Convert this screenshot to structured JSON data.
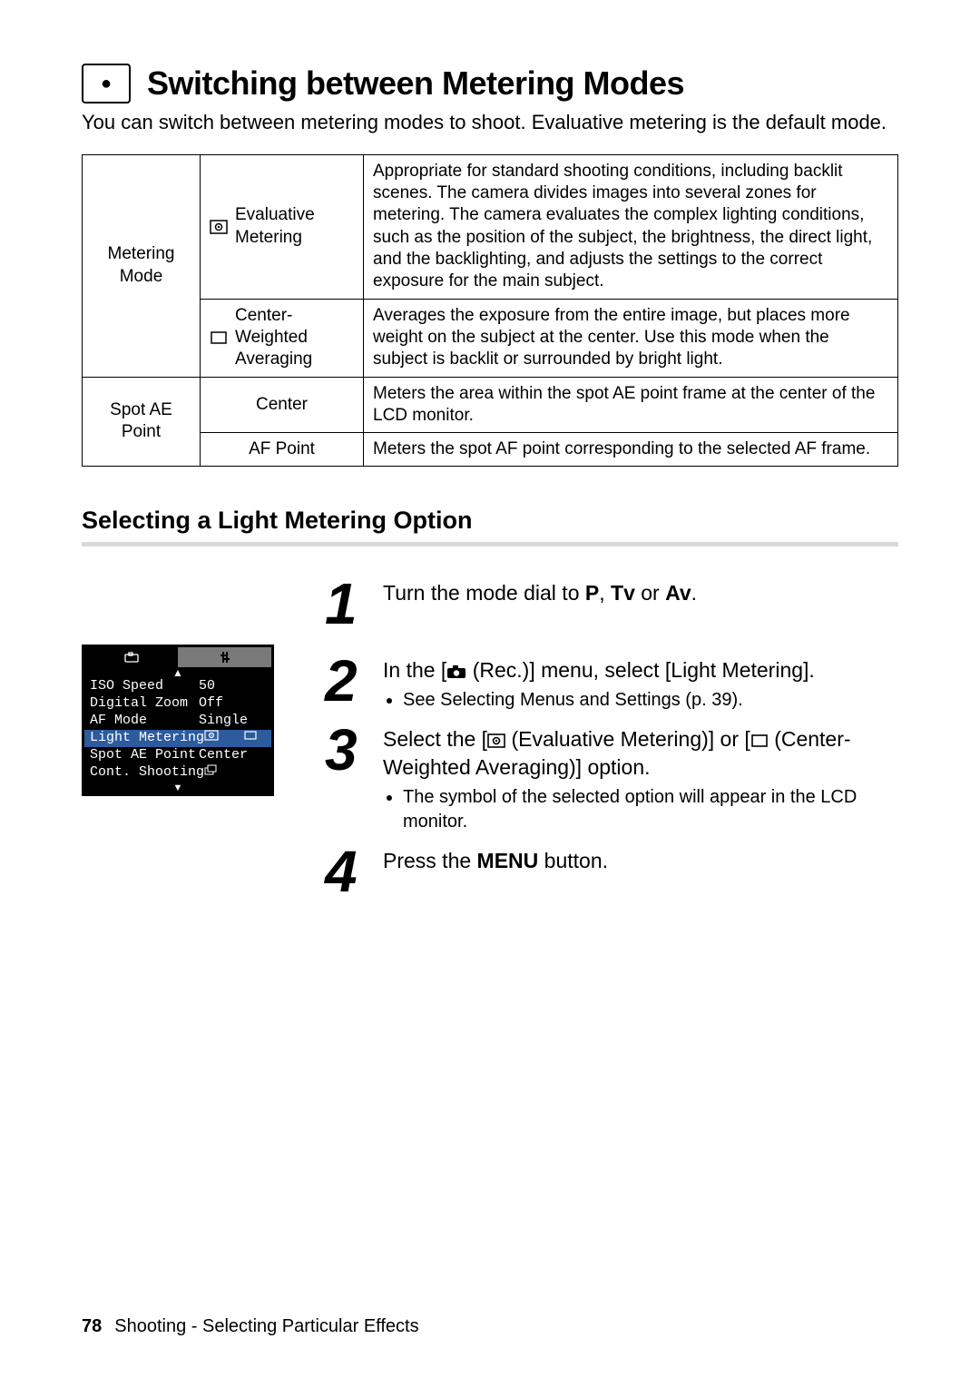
{
  "title": "Switching between Metering Modes",
  "intro": "You can switch between metering modes to shoot. Evaluative metering is the default mode.",
  "table": {
    "rows": [
      {
        "group": "Metering Mode",
        "label": "Evaluative Metering",
        "icon": "evaluative-metering-icon",
        "desc": "Appropriate for standard shooting conditions, including backlit scenes. The camera divides images into several zones for metering. The camera evaluates the complex lighting conditions, such as the position of the subject, the brightness, the direct light, and the backlighting, and adjusts the settings to the correct exposure for the main subject."
      },
      {
        "group": "Metering Mode",
        "label": "Center-Weighted Averaging",
        "icon": "center-weighted-icon",
        "desc": "Averages the exposure from the entire image, but places more weight on the subject at the center. Use this mode when the subject is backlit or surrounded by bright light."
      },
      {
        "group": "Spot AE Point",
        "label": "Center",
        "icon": "",
        "desc": "Meters the area within the spot AE point frame at the center of the LCD monitor."
      },
      {
        "group": "Spot AE Point",
        "label": "AF Point",
        "icon": "",
        "desc": "Meters the spot AF point corresponding to the selected AF frame."
      }
    ]
  },
  "subhead": "Selecting a Light Metering Option",
  "lcd": {
    "rows": [
      {
        "label": "ISO Speed",
        "value": "50",
        "selected": false
      },
      {
        "label": "Digital Zoom",
        "value": "Off",
        "selected": false
      },
      {
        "label": "AF Mode",
        "value": "Single",
        "selected": false
      },
      {
        "label": "Light Metering",
        "value": "",
        "icons": [
          "evaluative-metering-icon",
          "center-weighted-icon"
        ],
        "selected": true
      },
      {
        "label": "Spot AE Point",
        "value": "Center",
        "selected": false
      },
      {
        "label": "Cont. Shooting",
        "value": "",
        "icons": [
          "continuous-icon"
        ],
        "selected": false
      }
    ]
  },
  "steps": {
    "s1": {
      "prefix": "Turn the mode dial to ",
      "modes": [
        "P",
        "Tv",
        "Av"
      ],
      "join_or": "or",
      "suffix": "."
    },
    "s2": {
      "prefix": "In the [",
      "rec": "(Rec.)] menu, select [Light Metering].",
      "bullet": "See Selecting Menus and Settings (p. 39)."
    },
    "s3": {
      "prefix": "Select the [",
      "opt1": "(Evaluative Metering)] or [",
      "opt2": "(Center-Weighted Averaging)] option.",
      "bullet": "The symbol of the selected option will appear in the LCD monitor."
    },
    "s4": {
      "prefix": "Press the ",
      "menu": "MENU",
      "suffix": " button."
    }
  },
  "footer": {
    "page": "78",
    "text": "Shooting - Selecting Particular Effects"
  }
}
